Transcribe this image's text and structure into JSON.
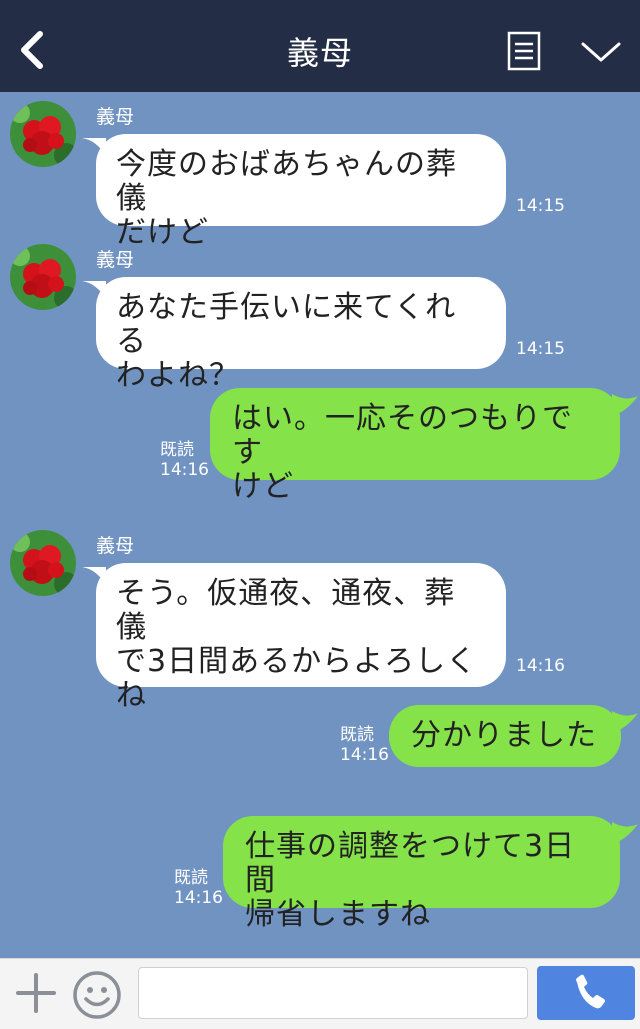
{
  "header": {
    "title": "義母"
  },
  "messages": [
    {
      "sender": "義母",
      "lines": [
        "今度のおばあちゃんの葬儀",
        "だけど"
      ],
      "time": "14:15"
    },
    {
      "sender": "義母",
      "lines": [
        "あなた手伝いに来てくれる",
        "わよね？"
      ],
      "time": "14:15"
    },
    {
      "read": "既読",
      "lines": [
        "はい。一応そのつもりです",
        "けど"
      ],
      "time": "14:16"
    },
    {
      "sender": "義母",
      "lines": [
        "そう。仮通夜、通夜、葬儀",
        "で3日間あるからよろしく",
        "ね"
      ],
      "time": "14:16"
    },
    {
      "read": "既読",
      "lines": [
        "分かりました"
      ],
      "time": "14:16"
    },
    {
      "read": "既読",
      "lines": [
        "仕事の調整をつけて3日間",
        "帰省しますね"
      ],
      "time": "14:16"
    }
  ],
  "colors": {
    "header_bg": "#232d45",
    "chat_bg": "#7193c2",
    "incoming_bubble": "#ffffff",
    "outgoing_bubble": "#85e249",
    "call_button": "#4f84e0"
  },
  "icons": {
    "back": "chevron-left-icon",
    "memo": "document-icon",
    "menu": "chevron-down-icon",
    "plus": "plus-icon",
    "emoji": "smile-icon",
    "call": "phone-icon"
  }
}
